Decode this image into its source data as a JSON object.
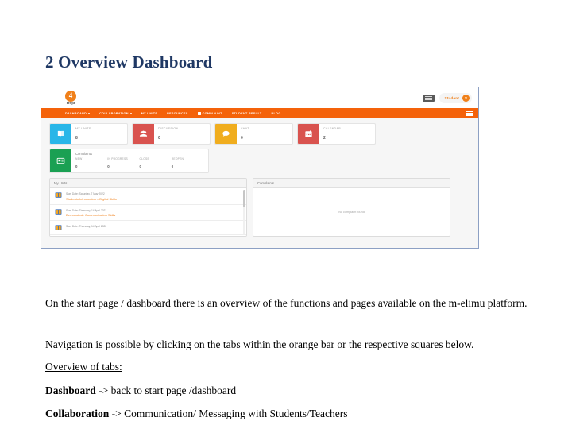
{
  "document": {
    "heading": "2 Overview Dashboard",
    "heading_color": "#1f3864",
    "paragraphs": {
      "intro": "On the start page / dashboard there is an overview of the functions and pages available on the m-elimu platform.",
      "navigation": "Navigation is possible by clicking on the tabs within the orange bar or the respective squares below.",
      "overview_label": "Overview of tabs:",
      "tab_dashboard_term": "Dashboard",
      "tab_dashboard_desc": " -> back to start page /dashboard",
      "tab_collaboration_term": "Collaboration",
      "tab_collaboration_desc": " -> Communication/ Messaging with Students/Teachers"
    }
  },
  "screenshot": {
    "header": {
      "brand_mark": "4",
      "brand_text": "kenya",
      "user_label": "Student",
      "avatar_initial": "S",
      "accent_color": "#f0801a"
    },
    "navbar": {
      "bar_color": "#f4620a",
      "items": [
        {
          "label": "DASHBOARD",
          "caret": true,
          "square": false
        },
        {
          "label": "COLLABORATION",
          "caret": true,
          "square": false
        },
        {
          "label": "MY UNITS",
          "caret": false,
          "square": false
        },
        {
          "label": "RESOURCES",
          "caret": false,
          "square": false
        },
        {
          "label": "COMPLAINT",
          "caret": false,
          "square": true
        },
        {
          "label": "STUDENT RESULT",
          "caret": false,
          "square": false
        },
        {
          "label": "BLOG",
          "caret": false,
          "square": false
        }
      ]
    },
    "tiles": [
      {
        "label": "MY UNITS",
        "value": "8",
        "color": "#29b6e8",
        "icon": "book-icon"
      },
      {
        "label": "DISCUSSION",
        "value": "0",
        "color": "#d9534f",
        "icon": "users-icon"
      },
      {
        "label": "CHAT",
        "value": "0",
        "color": "#f0ad1e",
        "icon": "chat-icon"
      },
      {
        "label": "CALENDAR",
        "value": "2",
        "color": "#d9534f",
        "icon": "calendar-icon"
      }
    ],
    "complaints_tile": {
      "title": "Complaints",
      "color": "#1aa053",
      "icon": "card-icon",
      "columns": [
        {
          "label": "NEW",
          "value": "0"
        },
        {
          "label": "IN PROGRESS",
          "value": "0"
        },
        {
          "label": "CLOSE",
          "value": "0"
        },
        {
          "label": "REOPEN",
          "value": "0"
        }
      ]
    },
    "units_panel": {
      "title": "My Units",
      "rows": [
        {
          "date": "Start Date: Saturday, 7 May 2022",
          "title": "Students Introduction – Digital Skills"
        },
        {
          "date": "Start Date: Thursday, 14 April 2022",
          "title": "Demonstrate Communication Skills"
        },
        {
          "date": "Start Date: Thursday, 14 April 2022",
          "title": ""
        }
      ]
    },
    "complaints_panel": {
      "title": "Complaints",
      "empty_message": "No complaint found"
    }
  }
}
